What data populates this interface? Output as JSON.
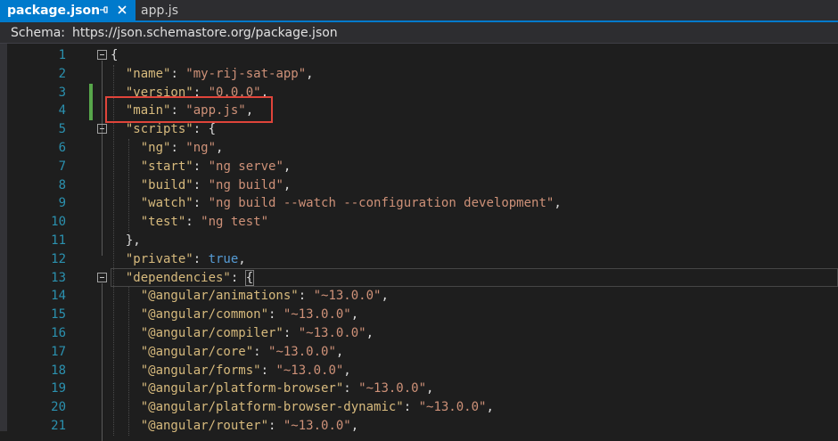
{
  "tabs": [
    {
      "label": "package.json",
      "active": true
    },
    {
      "label": "app.js",
      "active": false
    }
  ],
  "schema": {
    "label": "Schema:",
    "url": "https://json.schemastore.org/package.json"
  },
  "editor": {
    "lines": [
      {
        "n": "1",
        "code": [
          {
            "t": "p",
            "v": "{"
          }
        ]
      },
      {
        "n": "2",
        "code": [
          {
            "t": "p",
            "v": "  "
          },
          {
            "t": "k",
            "v": "\"name\""
          },
          {
            "t": "p",
            "v": ": "
          },
          {
            "t": "s",
            "v": "\"my-rij-sat-app\""
          },
          {
            "t": "p",
            "v": ","
          }
        ]
      },
      {
        "n": "3",
        "code": [
          {
            "t": "p",
            "v": "  "
          },
          {
            "t": "k",
            "v": "\"version\""
          },
          {
            "t": "p",
            "v": ": "
          },
          {
            "t": "s",
            "v": "\"0.0.0\""
          },
          {
            "t": "p",
            "v": ","
          }
        ]
      },
      {
        "n": "4",
        "code": [
          {
            "t": "p",
            "v": "  "
          },
          {
            "t": "k",
            "v": "\"main\""
          },
          {
            "t": "p",
            "v": ": "
          },
          {
            "t": "s",
            "v": "\"app.js\""
          },
          {
            "t": "p",
            "v": ","
          }
        ]
      },
      {
        "n": "5",
        "code": [
          {
            "t": "p",
            "v": "  "
          },
          {
            "t": "k",
            "v": "\"scripts\""
          },
          {
            "t": "p",
            "v": ": {"
          }
        ]
      },
      {
        "n": "6",
        "code": [
          {
            "t": "p",
            "v": "    "
          },
          {
            "t": "k",
            "v": "\"ng\""
          },
          {
            "t": "p",
            "v": ": "
          },
          {
            "t": "s",
            "v": "\"ng\""
          },
          {
            "t": "p",
            "v": ","
          }
        ]
      },
      {
        "n": "7",
        "code": [
          {
            "t": "p",
            "v": "    "
          },
          {
            "t": "k",
            "v": "\"start\""
          },
          {
            "t": "p",
            "v": ": "
          },
          {
            "t": "s",
            "v": "\"ng serve\""
          },
          {
            "t": "p",
            "v": ","
          }
        ]
      },
      {
        "n": "8",
        "code": [
          {
            "t": "p",
            "v": "    "
          },
          {
            "t": "k",
            "v": "\"build\""
          },
          {
            "t": "p",
            "v": ": "
          },
          {
            "t": "s",
            "v": "\"ng build\""
          },
          {
            "t": "p",
            "v": ","
          }
        ]
      },
      {
        "n": "9",
        "code": [
          {
            "t": "p",
            "v": "    "
          },
          {
            "t": "k",
            "v": "\"watch\""
          },
          {
            "t": "p",
            "v": ": "
          },
          {
            "t": "s",
            "v": "\"ng build --watch --configuration development\""
          },
          {
            "t": "p",
            "v": ","
          }
        ]
      },
      {
        "n": "10",
        "code": [
          {
            "t": "p",
            "v": "    "
          },
          {
            "t": "k",
            "v": "\"test\""
          },
          {
            "t": "p",
            "v": ": "
          },
          {
            "t": "s",
            "v": "\"ng test\""
          }
        ]
      },
      {
        "n": "11",
        "code": [
          {
            "t": "p",
            "v": "  },"
          }
        ]
      },
      {
        "n": "12",
        "code": [
          {
            "t": "p",
            "v": "  "
          },
          {
            "t": "k",
            "v": "\"private\""
          },
          {
            "t": "p",
            "v": ": "
          },
          {
            "t": "b",
            "v": "true"
          },
          {
            "t": "p",
            "v": ","
          }
        ]
      },
      {
        "n": "13",
        "code": [
          {
            "t": "p",
            "v": "  "
          },
          {
            "t": "k",
            "v": "\"dependencies\""
          },
          {
            "t": "p",
            "v": ": "
          },
          {
            "t": "p",
            "v": "{"
          }
        ]
      },
      {
        "n": "14",
        "code": [
          {
            "t": "p",
            "v": "    "
          },
          {
            "t": "k",
            "v": "\"@angular/animations\""
          },
          {
            "t": "p",
            "v": ": "
          },
          {
            "t": "s",
            "v": "\"~13.0.0\""
          },
          {
            "t": "p",
            "v": ","
          }
        ]
      },
      {
        "n": "15",
        "code": [
          {
            "t": "p",
            "v": "    "
          },
          {
            "t": "k",
            "v": "\"@angular/common\""
          },
          {
            "t": "p",
            "v": ": "
          },
          {
            "t": "s",
            "v": "\"~13.0.0\""
          },
          {
            "t": "p",
            "v": ","
          }
        ]
      },
      {
        "n": "16",
        "code": [
          {
            "t": "p",
            "v": "    "
          },
          {
            "t": "k",
            "v": "\"@angular/compiler\""
          },
          {
            "t": "p",
            "v": ": "
          },
          {
            "t": "s",
            "v": "\"~13.0.0\""
          },
          {
            "t": "p",
            "v": ","
          }
        ]
      },
      {
        "n": "17",
        "code": [
          {
            "t": "p",
            "v": "    "
          },
          {
            "t": "k",
            "v": "\"@angular/core\""
          },
          {
            "t": "p",
            "v": ": "
          },
          {
            "t": "s",
            "v": "\"~13.0.0\""
          },
          {
            "t": "p",
            "v": ","
          }
        ]
      },
      {
        "n": "18",
        "code": [
          {
            "t": "p",
            "v": "    "
          },
          {
            "t": "k",
            "v": "\"@angular/forms\""
          },
          {
            "t": "p",
            "v": ": "
          },
          {
            "t": "s",
            "v": "\"~13.0.0\""
          },
          {
            "t": "p",
            "v": ","
          }
        ]
      },
      {
        "n": "19",
        "code": [
          {
            "t": "p",
            "v": "    "
          },
          {
            "t": "k",
            "v": "\"@angular/platform-browser\""
          },
          {
            "t": "p",
            "v": ": "
          },
          {
            "t": "s",
            "v": "\"~13.0.0\""
          },
          {
            "t": "p",
            "v": ","
          }
        ]
      },
      {
        "n": "20",
        "code": [
          {
            "t": "p",
            "v": "    "
          },
          {
            "t": "k",
            "v": "\"@angular/platform-browser-dynamic\""
          },
          {
            "t": "p",
            "v": ": "
          },
          {
            "t": "s",
            "v": "\"~13.0.0\""
          },
          {
            "t": "p",
            "v": ","
          }
        ]
      },
      {
        "n": "21",
        "code": [
          {
            "t": "p",
            "v": "    "
          },
          {
            "t": "k",
            "v": "\"@angular/router\""
          },
          {
            "t": "p",
            "v": ": "
          },
          {
            "t": "s",
            "v": "\"~13.0.0\""
          },
          {
            "t": "p",
            "v": ","
          }
        ]
      }
    ]
  },
  "colors": {
    "accent": "#007acc",
    "highlight_box": "#e0443a",
    "change_marker": "#57a64a"
  },
  "icons": {
    "pin": "pin-icon",
    "close": "close-icon"
  }
}
